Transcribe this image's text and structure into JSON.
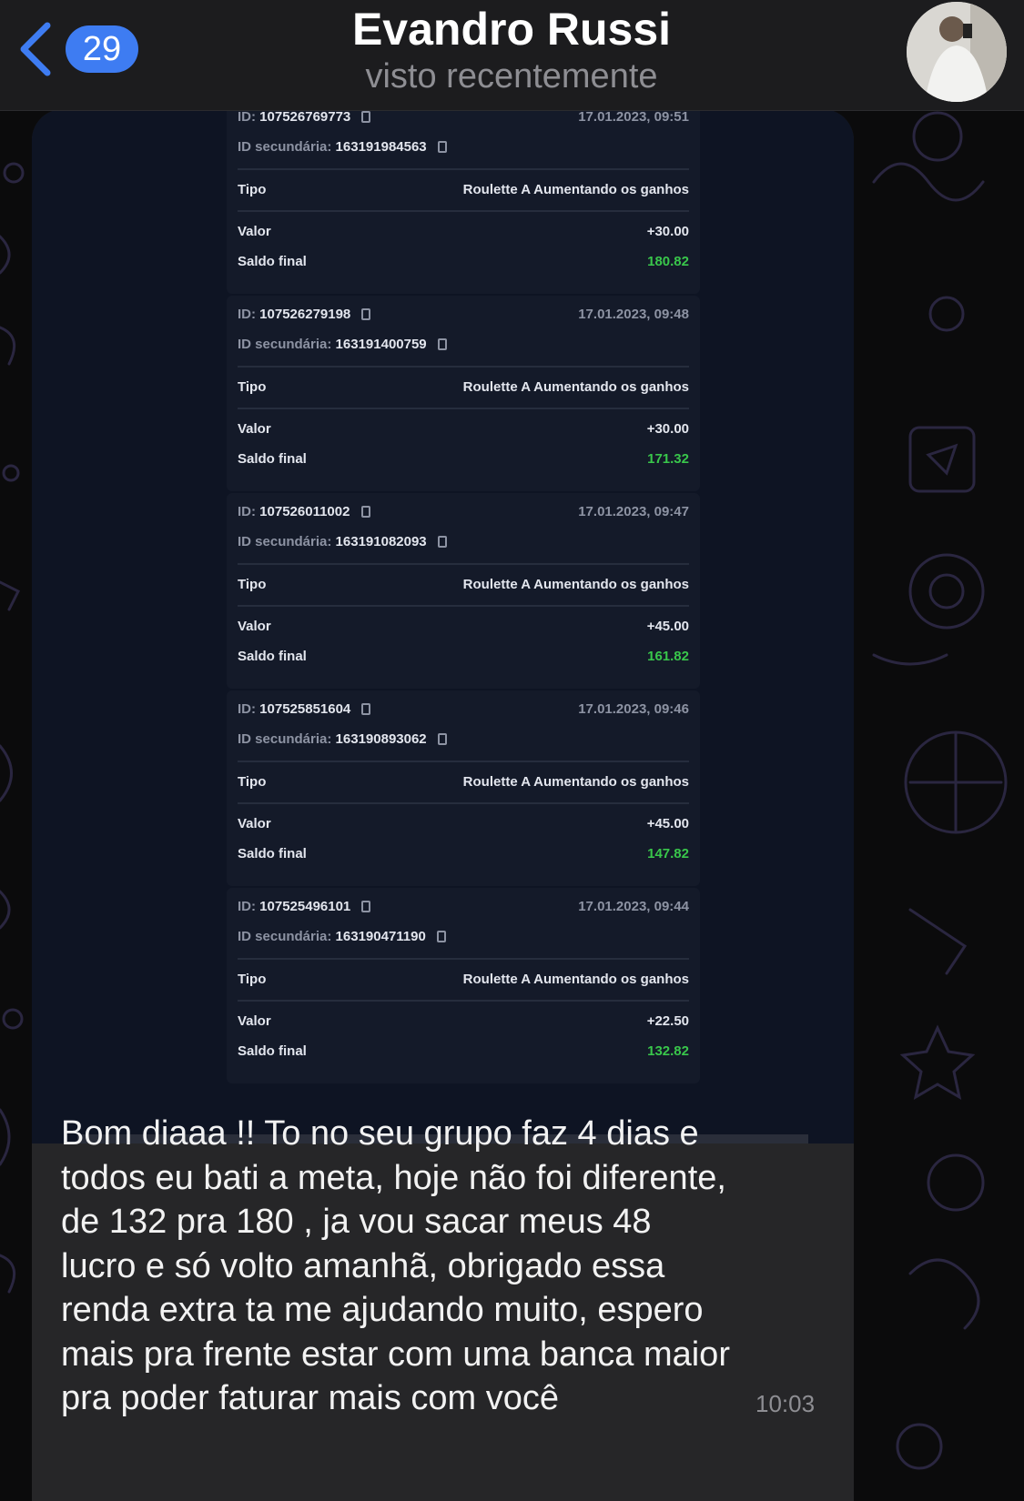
{
  "header": {
    "back_badge": "29",
    "contact_name": "Evandro Russi",
    "status": "visto recentemente"
  },
  "colors": {
    "accent": "#3e7cf2",
    "bubble": "#262628",
    "positive_balance": "#39c64b"
  },
  "transactions": [
    {
      "id_label": "ID:",
      "id": "107526769773",
      "date": "17.01.2023, 09:51",
      "sec_label": "ID secundária:",
      "secondary_id": "163191984563",
      "tipo_label": "Tipo",
      "tipo": "Roulette A Aumentando os ganhos",
      "valor_label": "Valor",
      "valor": "+30.00",
      "saldo_label": "Saldo final",
      "saldo": "180.82"
    },
    {
      "id_label": "ID:",
      "id": "107526279198",
      "date": "17.01.2023, 09:48",
      "sec_label": "ID secundária:",
      "secondary_id": "163191400759",
      "tipo_label": "Tipo",
      "tipo": "Roulette A Aumentando os ganhos",
      "valor_label": "Valor",
      "valor": "+30.00",
      "saldo_label": "Saldo final",
      "saldo": "171.32"
    },
    {
      "id_label": "ID:",
      "id": "107526011002",
      "date": "17.01.2023, 09:47",
      "sec_label": "ID secundária:",
      "secondary_id": "163191082093",
      "tipo_label": "Tipo",
      "tipo": "Roulette A Aumentando os ganhos",
      "valor_label": "Valor",
      "valor": "+45.00",
      "saldo_label": "Saldo final",
      "saldo": "161.82"
    },
    {
      "id_label": "ID:",
      "id": "107525851604",
      "date": "17.01.2023, 09:46",
      "sec_label": "ID secundária:",
      "secondary_id": "163190893062",
      "tipo_label": "Tipo",
      "tipo": "Roulette A Aumentando os ganhos",
      "valor_label": "Valor",
      "valor": "+45.00",
      "saldo_label": "Saldo final",
      "saldo": "147.82"
    },
    {
      "id_label": "ID:",
      "id": "107525496101",
      "date": "17.01.2023, 09:44",
      "sec_label": "ID secundária:",
      "secondary_id": "163190471190",
      "tipo_label": "Tipo",
      "tipo": "Roulette A Aumentando os ganhos",
      "valor_label": "Valor",
      "valor": "+22.50",
      "saldo_label": "Saldo final",
      "saldo": "132.82"
    }
  ],
  "message": {
    "lines": [
      "Bom diaaa !! To no seu grupo faz 4 dias e",
      "todos eu bati a meta, hoje não foi diferente,",
      "de 132 pra 180 , ja vou sacar meus 48",
      "lucro e só volto amanhã, obrigado essa",
      "renda extra ta me ajudando muito, espero",
      "mais pra frente estar com uma banca maior",
      "pra poder faturar mais com você"
    ],
    "time": "10:03"
  }
}
